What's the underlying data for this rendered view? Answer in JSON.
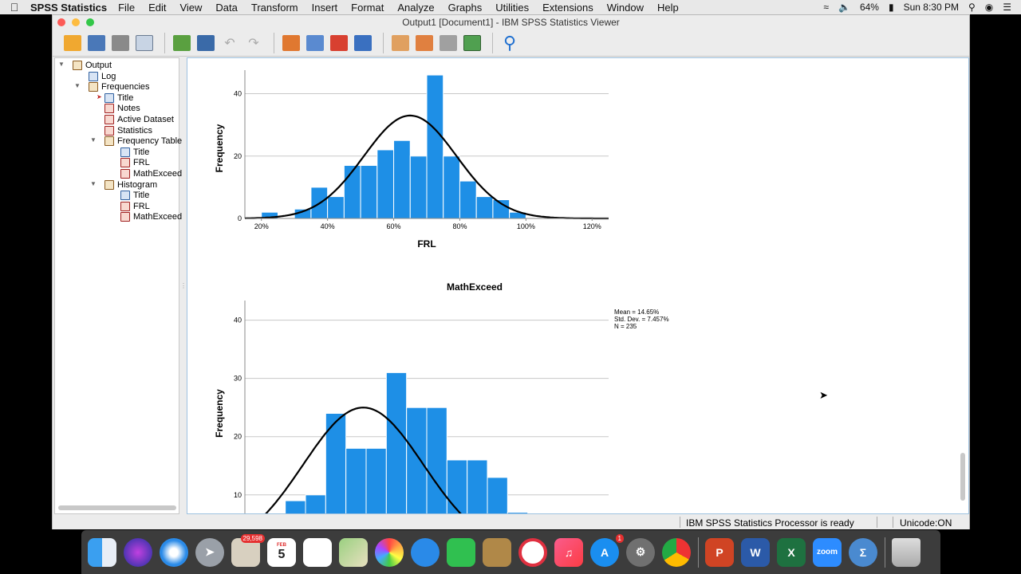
{
  "menubar": {
    "app_name": "SPSS Statistics",
    "items": [
      "File",
      "Edit",
      "View",
      "Data",
      "Transform",
      "Insert",
      "Format",
      "Analyze",
      "Graphs",
      "Utilities",
      "Extensions",
      "Window",
      "Help"
    ],
    "battery": "64%",
    "clock": "Sun 8:30 PM"
  },
  "window": {
    "title": "Output1 [Document1] - IBM SPSS Statistics Viewer"
  },
  "tree": {
    "root": "Output",
    "log": "Log",
    "frequencies": "Frequencies",
    "title": "Title",
    "notes": "Notes",
    "active_dataset": "Active Dataset",
    "statistics": "Statistics",
    "frequency_table": "Frequency Table",
    "ft_title": "Title",
    "ft_frl": "FRL",
    "ft_mathexceed": "MathExceed",
    "histogram": "Histogram",
    "h_title": "Title",
    "h_frl": "FRL",
    "h_mathexceed": "MathExceed"
  },
  "chart_data": [
    {
      "type": "bar",
      "xlabel": "FRL",
      "ylabel": "Frequency",
      "x_ticks": [
        "20%",
        "40%",
        "60%",
        "80%",
        "100%",
        "120%"
      ],
      "y_ticks": [
        0,
        20,
        40
      ],
      "xlim": [
        0.15,
        1.25
      ],
      "ylim": [
        0,
        45
      ],
      "bin_width": 0.05,
      "bins_start": [
        0.2,
        0.25,
        0.3,
        0.35,
        0.4,
        0.45,
        0.5,
        0.55,
        0.6,
        0.65,
        0.7,
        0.75,
        0.8,
        0.85,
        0.9,
        0.95
      ],
      "values": [
        2,
        0,
        3,
        10,
        7,
        17,
        17,
        22,
        25,
        20,
        46,
        20,
        12,
        7,
        6,
        2
      ],
      "normal_curve": {
        "mean": 0.65,
        "sd": 0.14,
        "peak": 33
      },
      "bar_color": "#1e8fe6",
      "grid": true
    },
    {
      "type": "bar",
      "title": "MathExceed",
      "ylabel": "Frequency",
      "y_ticks": [
        10,
        20,
        30,
        40
      ],
      "ylim": [
        6,
        42
      ],
      "xlim": [
        0,
        45
      ],
      "bin_width": 2.5,
      "bins_start": [
        5,
        7.5,
        10,
        12.5,
        15,
        17.5,
        20,
        22.5,
        25,
        27.5,
        30,
        32.5
      ],
      "values": [
        9,
        10,
        24,
        18,
        18,
        31,
        25,
        25,
        16,
        16,
        13,
        7
      ],
      "normal_curve": {
        "mean": 14.65,
        "sd": 7.457,
        "peak": 25
      },
      "stats": [
        "Mean = 14.65%",
        "Std. Dev. = 7.457%",
        "N = 235"
      ],
      "bar_color": "#1e8fe6",
      "grid": true
    }
  ],
  "statusbar": {
    "ready": "IBM SPSS Statistics Processor is ready",
    "unicode": "Unicode:ON"
  },
  "dock": {
    "mail_badge": "29,598",
    "calendar_month": "FEB",
    "calendar_day": "5",
    "appstore_badge": "1",
    "word": "W",
    "excel": "X",
    "powerpoint": "P",
    "zoom": "zoom"
  },
  "colors": {
    "bar": "#1e8fe6",
    "window_bg": "#ececec",
    "content_border": "#9ec2e0"
  }
}
